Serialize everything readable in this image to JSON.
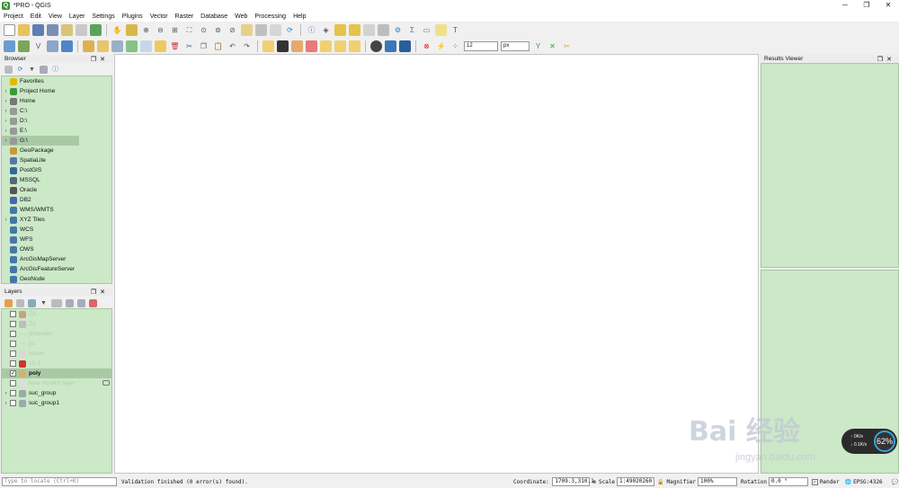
{
  "window": {
    "title": "*PRO - QGIS",
    "minimize": "─",
    "restore": "❐",
    "close": "✕"
  },
  "menu": [
    "Project",
    "Edit",
    "View",
    "Layer",
    "Settings",
    "Plugins",
    "Vector",
    "Raster",
    "Database",
    "Web",
    "Processing",
    "Help"
  ],
  "toolbar": {
    "font_size": "12",
    "unit": "px"
  },
  "browser": {
    "title": "Browser",
    "items": [
      {
        "label": "Favorites",
        "icon": "star-icon",
        "color": "#e6b800",
        "arrow": ""
      },
      {
        "label": "Project Home",
        "icon": "home-icon",
        "color": "#3c9a3c",
        "arrow": "›"
      },
      {
        "label": "Home",
        "icon": "home-icon",
        "color": "#777",
        "arrow": "›"
      },
      {
        "label": "C:\\",
        "icon": "folder-icon",
        "color": "#999",
        "arrow": "›"
      },
      {
        "label": "D:\\",
        "icon": "folder-icon",
        "color": "#999",
        "arrow": "›"
      },
      {
        "label": "E:\\",
        "icon": "folder-icon",
        "color": "#999",
        "arrow": "›"
      },
      {
        "label": "G:\\",
        "icon": "folder-icon",
        "color": "#999",
        "arrow": "›",
        "selected": true
      },
      {
        "label": "GeoPackage",
        "icon": "geopackage-icon",
        "color": "#c89a3a",
        "arrow": ""
      },
      {
        "label": "SpatiaLite",
        "icon": "feather-icon",
        "color": "#5577aa",
        "arrow": ""
      },
      {
        "label": "PostGIS",
        "icon": "elephant-icon",
        "color": "#336699",
        "arrow": ""
      },
      {
        "label": "MSSQL",
        "icon": "mssql-icon",
        "color": "#556677",
        "arrow": ""
      },
      {
        "label": "Oracle",
        "icon": "oracle-icon",
        "color": "#555",
        "arrow": ""
      },
      {
        "label": "DB2",
        "icon": "db2-icon",
        "color": "#4466aa",
        "arrow": ""
      },
      {
        "label": "WMS/WMTS",
        "icon": "globe-icon",
        "color": "#4477aa",
        "arrow": ""
      },
      {
        "label": "XYZ Tiles",
        "icon": "grid-icon",
        "color": "#4477aa",
        "arrow": "›"
      },
      {
        "label": "WCS",
        "icon": "globe-icon",
        "color": "#4477aa",
        "arrow": ""
      },
      {
        "label": "WFS",
        "icon": "globe-icon",
        "color": "#4477aa",
        "arrow": ""
      },
      {
        "label": "OWS",
        "icon": "globe-icon",
        "color": "#4477aa",
        "arrow": ""
      },
      {
        "label": "ArcGisMapServer",
        "icon": "globe-icon",
        "color": "#4477aa",
        "arrow": ""
      },
      {
        "label": "ArcGisFeatureServer",
        "icon": "globe-icon",
        "color": "#4477aa",
        "arrow": ""
      },
      {
        "label": "GeoNode",
        "icon": "geonode-icon",
        "color": "#4477aa",
        "arrow": ""
      }
    ]
  },
  "layers": {
    "title": "Layers",
    "items": [
      {
        "label": "ZA",
        "color": "#c8a07a",
        "dim": true,
        "checked": false,
        "arrow": ""
      },
      {
        "label": "ZA",
        "color": "#bdbdbd",
        "dim": true,
        "checked": false,
        "arrow": ""
      },
      {
        "label": "jinturelan",
        "color": "",
        "dim": true,
        "checked": false,
        "arrow": "",
        "line": true
      },
      {
        "label": "jrs",
        "color": "",
        "dim": true,
        "checked": false,
        "arrow": "",
        "line": true
      },
      {
        "label": "mown",
        "color": "#d8d8d8",
        "dim": true,
        "checked": false,
        "arrow": ""
      },
      {
        "label": "12-1",
        "color": "#cc3333",
        "dim": true,
        "checked": false,
        "arrow": ""
      },
      {
        "label": "poly",
        "color": "#d4b36b",
        "dim": false,
        "checked": true,
        "arrow": "",
        "selected": true,
        "bold": true
      },
      {
        "label": "New scratch layer",
        "color": "#dddddd",
        "dim": true,
        "checked": false,
        "arrow": ""
      },
      {
        "label": "suc_group",
        "color": "#9aa",
        "dim": false,
        "checked": false,
        "arrow": "›",
        "group": true
      },
      {
        "label": "suc_group1",
        "color": "#9aa",
        "dim": false,
        "checked": false,
        "arrow": "›",
        "group": true
      }
    ]
  },
  "results": {
    "title": "Results Viewer"
  },
  "status": {
    "locate_placeholder": "Type to locate (Ctrl+K)",
    "message": "Validation finished (0 error(s) found).",
    "coordinate_label": "Coordinate",
    "coordinate": "1709.3,310.1",
    "scale_label": "Scale",
    "scale": "1:49020260",
    "magnifier_label": "Magnifier",
    "magnifier": "100%",
    "rotation_label": "Rotation",
    "rotation": "0.0 °",
    "render_label": "Render",
    "crs": "EPSG:4326"
  },
  "overlay": {
    "percent": "62%",
    "up": "0K/s",
    "down": "0.1K/s"
  },
  "watermark": {
    "brand": "Bai 经验",
    "url": "jingyan.baidu.com"
  }
}
